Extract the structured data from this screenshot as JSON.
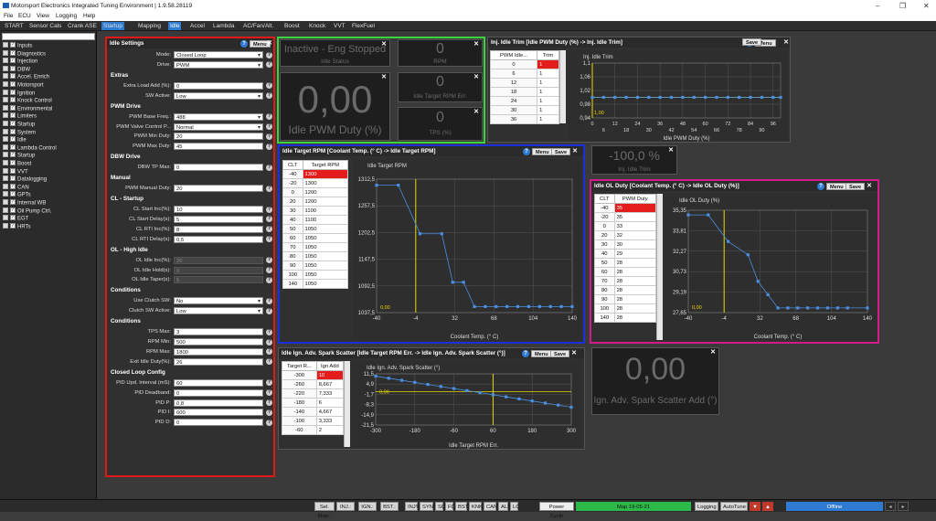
{
  "window": {
    "title": "Motorsport Electronics Integrated Tuning Environment | 1.9.58.28119"
  },
  "menu": [
    "File",
    "ECU",
    "View",
    "Logging",
    "Help"
  ],
  "tabs": [
    "START",
    "Sensor Cals",
    "Crank ASE",
    "Startup",
    "Mapping",
    "Idle",
    "Accel",
    "Lambda",
    "AC/Fan/Alt.",
    "Boost",
    "Knock",
    "VVT",
    "FlexFuel"
  ],
  "active_tab": "Idle",
  "sidebar": {
    "items": [
      "Inputs",
      "Diagnostics",
      "Injection",
      "DBW",
      "Accel. Enrich",
      "Motorsport",
      "Ignition",
      "Knock Control",
      "Environmental",
      "Limiters",
      "Startup",
      "System",
      "Idle",
      "Lambda Control",
      "Startup",
      "Boost",
      "VVT",
      "Datalogging",
      "CAN",
      "GPTs",
      "Internal WB",
      "Oil Pump Ctrl.",
      "EGT",
      "HRTs"
    ]
  },
  "idle_settings": {
    "title": "Idle Settings",
    "menu_label": "Menu",
    "rows": [
      {
        "type": "field",
        "label": "Mode:",
        "value": "Closed Loop",
        "kind": "select"
      },
      {
        "type": "field",
        "label": "Drive:",
        "value": "PWM",
        "kind": "select"
      },
      {
        "type": "section",
        "label": "Extras"
      },
      {
        "type": "field",
        "label": "Extra Load Add (%):",
        "value": "0",
        "kind": "input"
      },
      {
        "type": "field",
        "label": "SW Active:",
        "value": "Low",
        "kind": "select"
      },
      {
        "type": "section",
        "label": "PWM Drive"
      },
      {
        "type": "field",
        "label": "PWM Base Freq.:",
        "value": "488",
        "kind": "select"
      },
      {
        "type": "field",
        "label": "PWM Valve Control P...",
        "value": "Normal",
        "kind": "select"
      },
      {
        "type": "field",
        "label": "PWM Min Duty:",
        "value": "20",
        "kind": "input"
      },
      {
        "type": "field",
        "label": "PWM Max Duty:",
        "value": "45",
        "kind": "input"
      },
      {
        "type": "section",
        "label": "DBW Drive"
      },
      {
        "type": "field",
        "label": "DBW TP Max:",
        "value": "0",
        "kind": "input"
      },
      {
        "type": "section",
        "label": "Manual"
      },
      {
        "type": "field",
        "label": "PWM Manual Duty:",
        "value": "20",
        "kind": "input"
      },
      {
        "type": "section",
        "label": "CL - Startup"
      },
      {
        "type": "field",
        "label": "CL Start Inc(%):",
        "value": "10",
        "kind": "input"
      },
      {
        "type": "field",
        "label": "CL Start Delay(s):",
        "value": "5",
        "kind": "input"
      },
      {
        "type": "field",
        "label": "CL RTI Inc(%):",
        "value": "8",
        "kind": "input"
      },
      {
        "type": "field",
        "label": "CL RTI Delay(s):",
        "value": "0,5",
        "kind": "input"
      },
      {
        "type": "section",
        "label": "OL - High Idle"
      },
      {
        "type": "field",
        "label": "OL Idle Inc(%):",
        "value": "20",
        "kind": "disabled"
      },
      {
        "type": "field",
        "label": "OL Idle Hold(s):",
        "value": "0",
        "kind": "disabled"
      },
      {
        "type": "field",
        "label": "OL Idle Taper(s):",
        "value": "5",
        "kind": "disabled"
      },
      {
        "type": "section",
        "label": "Conditions"
      },
      {
        "type": "field",
        "label": "Use Clutch SW:",
        "value": "No",
        "kind": "select"
      },
      {
        "type": "field",
        "label": "Clutch SW Active:",
        "value": "Low",
        "kind": "select"
      },
      {
        "type": "section",
        "label": "Conditions"
      },
      {
        "type": "field",
        "label": "TPS Max:",
        "value": "3",
        "kind": "input"
      },
      {
        "type": "field",
        "label": "RPM Min:",
        "value": "500",
        "kind": "input"
      },
      {
        "type": "field",
        "label": "RPM Max:",
        "value": "1800",
        "kind": "input"
      },
      {
        "type": "field",
        "label": "Exit Idle Duty(%):",
        "value": "26",
        "kind": "input"
      },
      {
        "type": "section",
        "label": "Closed Loop Config"
      },
      {
        "type": "field",
        "label": "PID Upd. Interval (mS):",
        "value": "60",
        "kind": "input"
      },
      {
        "type": "field",
        "label": "PID Deadband:",
        "value": "0",
        "kind": "input"
      },
      {
        "type": "field",
        "label": "PID P:",
        "value": "0,8",
        "kind": "input"
      },
      {
        "type": "field",
        "label": "PID I:",
        "value": "600",
        "kind": "input"
      },
      {
        "type": "field",
        "label": "PID D:",
        "value": "0",
        "kind": "input"
      }
    ]
  },
  "gauges": {
    "idle_status": {
      "value": "Inactive - Eng Stopped",
      "label": "Idle Status"
    },
    "rpm": {
      "value": "0",
      "label": "RPM"
    },
    "idle_pwm": {
      "value": "0,00",
      "label": "Idle PWM Duty (%)"
    },
    "idle_rpm_err": {
      "value": "0",
      "label": "Idle Target RPM Err."
    },
    "tps": {
      "value": "0",
      "label": "TPS (%)"
    },
    "inj_idle_trim": {
      "value": "-100,0 %",
      "label": "Inj. Idle Trim"
    },
    "spark_scatter": {
      "value": "0,00",
      "label": "Ign. Adv. Spark Scatter Add (°)"
    }
  },
  "inj_trim_panel": {
    "title": "Inj. Idle Trim [Idle PWM Duty (%) -> Inj. Idle Trim]",
    "col1": "PWM Idle...",
    "col2": "Trim",
    "rows": [
      [
        "0",
        "1"
      ],
      [
        "6",
        "1"
      ],
      [
        "12",
        "1"
      ],
      [
        "18",
        "1"
      ],
      [
        "24",
        "1"
      ],
      [
        "30",
        "1"
      ],
      [
        "36",
        "1"
      ]
    ],
    "menu_label": "Menu",
    "save_label": "Save",
    "plot_title": "Inj. Idle Trim",
    "cursor_label": "1,00"
  },
  "target_rpm_panel": {
    "title": "Idle Target RPM [Coolant Temp. (° C) -> Idle Target RPM]",
    "col1": "CLT",
    "col2": "Target RPM",
    "rows": [
      [
        "-40",
        "1300"
      ],
      [
        "-20",
        "1300"
      ],
      [
        "0",
        "1200"
      ],
      [
        "20",
        "1200"
      ],
      [
        "30",
        "1100"
      ],
      [
        "40",
        "1100"
      ],
      [
        "50",
        "1050"
      ],
      [
        "60",
        "1050"
      ],
      [
        "70",
        "1050"
      ],
      [
        "80",
        "1050"
      ],
      [
        "90",
        "1050"
      ],
      [
        "100",
        "1050"
      ],
      [
        "140",
        "1050"
      ]
    ],
    "menu_label": "Menu",
    "save_label": "Save",
    "plot_title": "Idle Target RPM",
    "cursor_label": "0,00"
  },
  "ol_duty_panel": {
    "title": "Idle OL Duty [Coolant Temp. (° C) -> Idle OL Duty (%)]",
    "col1": "CLT",
    "col2": "PWM Duty",
    "rows": [
      [
        "-40",
        "35"
      ],
      [
        "-20",
        "35"
      ],
      [
        "0",
        "33"
      ],
      [
        "20",
        "32"
      ],
      [
        "30",
        "30"
      ],
      [
        "40",
        "29"
      ],
      [
        "50",
        "28"
      ],
      [
        "60",
        "28"
      ],
      [
        "70",
        "28"
      ],
      [
        "80",
        "28"
      ],
      [
        "90",
        "28"
      ],
      [
        "100",
        "28"
      ],
      [
        "140",
        "28"
      ]
    ],
    "menu_label": "Menu",
    "save_label": "Save",
    "plot_title": "Idle OL Duty (%)",
    "cursor_label": "0,00"
  },
  "spark_panel": {
    "title": "Idle Ign. Adv. Spark Scatter [Idle Target RPM Err. -> Idle Ign. Adv. Spark Scatter (°)]",
    "col1": "Target R...",
    "col2": "Ign Add",
    "rows": [
      [
        "-300",
        "10"
      ],
      [
        "-260",
        "8,667"
      ],
      [
        "-220",
        "7,333"
      ],
      [
        "-180",
        "6"
      ],
      [
        "-140",
        "4,667"
      ],
      [
        "-100",
        "3,333"
      ],
      [
        "-60",
        "2"
      ]
    ],
    "menu_label": "Menu",
    "save_label": "Save",
    "plot_title": "Idle Ign. Adv. Spark Scatter (°)",
    "cursor_label": "0,00"
  },
  "chart_data": [
    {
      "type": "line",
      "title": "Inj. Idle Trim",
      "xlabel": "Idle PWM Duty (%)",
      "ylabel": "",
      "x": [
        0,
        6,
        12,
        18,
        24,
        30,
        36,
        42,
        48,
        54,
        60,
        66,
        72,
        78,
        84,
        90,
        96,
        100
      ],
      "y": [
        1,
        1,
        1,
        1,
        1,
        1,
        1,
        1,
        1,
        1,
        1,
        1,
        1,
        1,
        1,
        1,
        1,
        1
      ],
      "xlim": [
        0,
        100
      ],
      "ylim": [
        0.94,
        1.1
      ],
      "xticks": [
        "0",
        "12",
        "24",
        "36",
        "48",
        "60",
        "72",
        "84",
        "96",
        "6",
        "18",
        "30",
        "42",
        "54",
        "66",
        "78",
        "90"
      ],
      "yticks": [
        "1,1",
        "1,06",
        "1,02",
        "0,98",
        "0,94"
      ],
      "cursor_x": 0,
      "color": "#4a90e2"
    },
    {
      "type": "line",
      "title": "Idle Target RPM",
      "xlabel": "Coolant Temp. (° C)",
      "ylabel": "",
      "x": [
        -40,
        -20,
        0,
        20,
        30,
        40,
        50,
        60,
        70,
        80,
        90,
        100,
        110,
        120,
        130,
        140
      ],
      "y": [
        1300,
        1300,
        1200,
        1200,
        1100,
        1100,
        1050,
        1050,
        1050,
        1050,
        1050,
        1050,
        1050,
        1050,
        1050,
        1050
      ],
      "xlim": [
        -40,
        140
      ],
      "ylim": [
        1037.5,
        1312.5
      ],
      "xticks": [
        "-40",
        "-4",
        "32",
        "68",
        "104",
        "140"
      ],
      "yticks": [
        "1312,5",
        "1257,5",
        "1202,5",
        "1147,5",
        "1092,5",
        "1037,5"
      ],
      "cursor_x": -4,
      "color": "#4a90e2"
    },
    {
      "type": "line",
      "title": "Idle OL Duty (%)",
      "xlabel": "Coolant Temp. (° C)",
      "ylabel": "",
      "x": [
        -40,
        -20,
        0,
        20,
        30,
        40,
        50,
        60,
        70,
        80,
        90,
        100,
        110,
        120,
        140
      ],
      "y": [
        35,
        35,
        33,
        32,
        30,
        29,
        28,
        28,
        28,
        28,
        28,
        28,
        28,
        28,
        28
      ],
      "xlim": [
        -40,
        140
      ],
      "ylim": [
        27.65,
        35.35
      ],
      "xticks": [
        "-40",
        "-4",
        "32",
        "68",
        "104",
        "140"
      ],
      "yticks": [
        "35,35",
        "33,81",
        "32,27",
        "30,73",
        "29,19",
        "27,65"
      ],
      "cursor_x": -4,
      "color": "#4a90e2"
    },
    {
      "type": "line",
      "title": "Idle Ign. Adv. Spark Scatter (°)",
      "xlabel": "Idle Target RPM Err.",
      "ylabel": "",
      "x": [
        -300,
        -260,
        -220,
        -180,
        -140,
        -100,
        -60,
        -20,
        20,
        60,
        100,
        140,
        180,
        220,
        260,
        300
      ],
      "y": [
        10,
        8.667,
        7.333,
        6,
        4.667,
        3.333,
        2,
        0.667,
        -0.667,
        -2,
        -3.333,
        -4.667,
        -6,
        -7.333,
        -8.667,
        -10
      ],
      "xlim": [
        -300,
        300
      ],
      "ylim": [
        -21.5,
        11.5
      ],
      "xticks": [
        "-300",
        "-180",
        "-60",
        "60",
        "180",
        "300"
      ],
      "yticks": [
        "11,5",
        "4,9",
        "-1,7",
        "-8,3",
        "-14,9",
        "-21,5"
      ],
      "cursor_x": 60,
      "color": "#4a90e2"
    }
  ],
  "statusbar": {
    "items": [
      "Sel. Map.:",
      "INJ.:",
      "IGN.:",
      "BST.:",
      "INJ%",
      "SYNC",
      "SC",
      "FC",
      "BST",
      "KNK",
      "CAN",
      "ALS",
      "LC",
      "Power Cycle",
      "Map 19-05-21",
      "Logging",
      "AutoTune",
      "Offline"
    ],
    "map_color": "#2db84a",
    "offline_color": "#2f7bd1"
  }
}
